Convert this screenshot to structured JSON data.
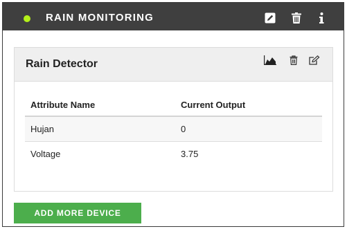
{
  "header": {
    "title": "RAIN MONITORING",
    "status_color": "#b4f01a",
    "icons": [
      "edit-icon",
      "trash-icon",
      "info-icon"
    ]
  },
  "device_card": {
    "title": "Rain Detector",
    "icons": [
      "area-chart-icon",
      "trash-icon",
      "edit-icon"
    ],
    "columns": [
      "Attribute Name",
      "Current Output"
    ],
    "rows": [
      {
        "name": "Hujan",
        "value": "0"
      },
      {
        "name": "Voltage",
        "value": "3.75"
      }
    ]
  },
  "add_button_label": "ADD MORE DEVICE",
  "colors": {
    "header_bg": "#3f3f3f",
    "button_bg": "#4cae4c"
  }
}
